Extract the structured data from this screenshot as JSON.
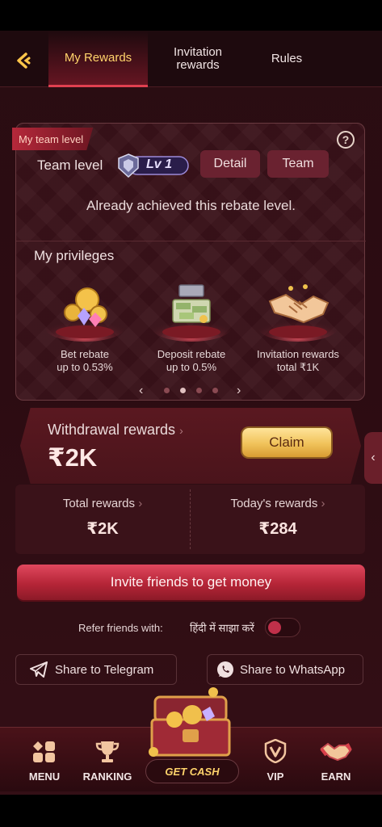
{
  "header": {
    "tabs": [
      {
        "label": "My Rewards",
        "active": true
      },
      {
        "label": "Invitation rewards",
        "active": false
      },
      {
        "label": "Rules",
        "active": false
      }
    ]
  },
  "team_card": {
    "tag": "My team level",
    "team_level_label": "Team level",
    "level_badge": "Lv 1",
    "detail_button": "Detail",
    "team_button": "Team",
    "status": "Already achieved this rebate level.",
    "privileges_title": "My privileges",
    "privileges": [
      {
        "line1": "Bet rebate",
        "line2": "up to 0.53%",
        "icon": "coins-icon"
      },
      {
        "line1": "Deposit rebate",
        "line2": "up to 0.5%",
        "icon": "treasure-chest-icon"
      },
      {
        "line1": "Invitation rewards",
        "line2": "total ₹1K",
        "icon": "handshake-icon"
      }
    ],
    "pager": {
      "pages": 4,
      "current_page": 2
    }
  },
  "withdrawal": {
    "label": "Withdrawal rewards",
    "amount": "₹2K",
    "claim_button": "Claim"
  },
  "totals": {
    "total_label": "Total rewards",
    "total_value": "₹2K",
    "today_label": "Today's rewards",
    "today_value": "₹284"
  },
  "invite_button": "Invite friends to get money",
  "refer": {
    "label": "Refer friends with:",
    "hindi_label": "हिंदी में साझा करें",
    "toggle_on": false
  },
  "share": {
    "telegram": "Share to Telegram",
    "whatsapp": "Share to WhatsApp"
  },
  "nav": {
    "menu": "MENU",
    "ranking": "RANKING",
    "get_cash": "GET CASH",
    "vip": "VIP",
    "earn": "EARN"
  },
  "colors": {
    "accent_gold": "#ffd36b",
    "active_red": "#e04050",
    "claim_gold": "#f0c25a",
    "invite_red": "#b52537"
  }
}
